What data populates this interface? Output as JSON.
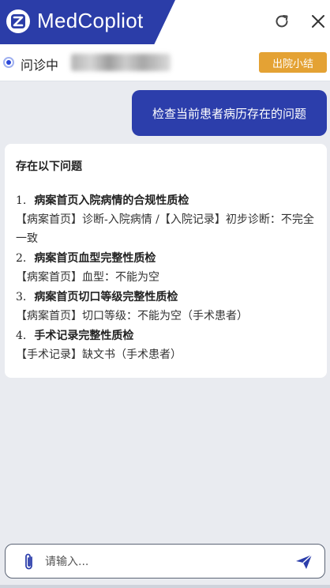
{
  "app": {
    "brand_name": "MedCopliot",
    "logo_icon": "z-logo-icon",
    "brand_color": "#2b3da8",
    "refresh_icon": "refresh-icon",
    "close_icon": "close-icon"
  },
  "status": {
    "label": "问诊中",
    "patient_name": "",
    "discharge_button": "出院小结",
    "discharge_color": "#e4a234"
  },
  "chat": {
    "user_message": "检查当前患者病历存在的问题",
    "response": {
      "title": "存在以下问题",
      "issues": [
        {
          "num": "1.",
          "title": "病案首页入院病情的合规性质检",
          "detail": "【病案首页】诊断-入院病情 /【入院记录】初步诊断：不完全一致"
        },
        {
          "num": "2.",
          "title": "病案首页血型完整性质检",
          "detail": "【病案首页】血型：不能为空"
        },
        {
          "num": "3.",
          "title": "病案首页切口等级完整性质检",
          "detail": "【病案首页】切口等级：不能为空（手术患者）"
        },
        {
          "num": "4.",
          "title": "手术记录完整性质检",
          "detail": "【手术记录】缺文书（手术患者）"
        }
      ]
    }
  },
  "composer": {
    "placeholder": "请输入...",
    "attach_icon": "paperclip-icon",
    "send_icon": "send-icon"
  }
}
